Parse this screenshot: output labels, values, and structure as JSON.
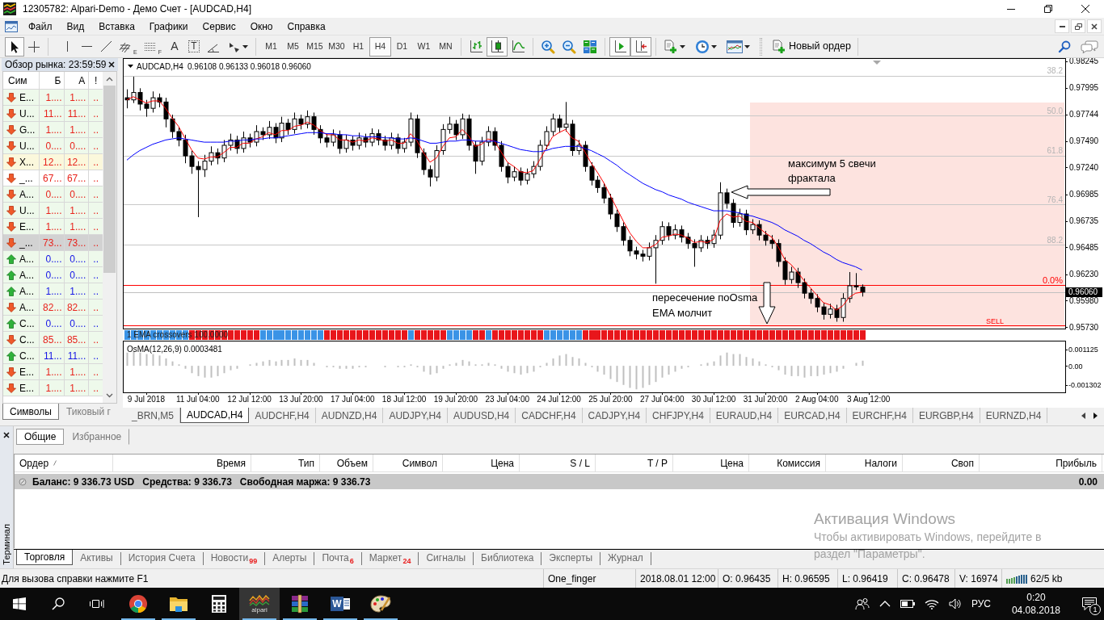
{
  "window": {
    "title": "12305782: Alpari-Demo - Демо Счет - [AUDCAD,H4]"
  },
  "menu": [
    "Файл",
    "Вид",
    "Вставка",
    "Графики",
    "Сервис",
    "Окно",
    "Справка"
  ],
  "toolbar": {
    "tools": [
      {
        "kind": "cursor",
        "selected": true
      },
      {
        "kind": "crosshair",
        "selected": false
      },
      {
        "kind": "vertical_line",
        "selected": false
      },
      {
        "kind": "horizontal_line",
        "selected": false
      },
      {
        "kind": "trend_line",
        "selected": false
      },
      {
        "kind": "fibo_channel",
        "label": "E",
        "selected": false
      },
      {
        "kind": "fibo",
        "label": "F",
        "selected": false
      },
      {
        "kind": "text",
        "label": "A",
        "selected": false
      },
      {
        "kind": "text_label",
        "label": "T",
        "selected": false
      },
      {
        "kind": "angle",
        "selected": false
      },
      {
        "kind": "arrows",
        "selected": false
      }
    ],
    "periods": [
      {
        "label": "M1",
        "selected": false
      },
      {
        "label": "M5",
        "selected": false
      },
      {
        "label": "M15",
        "selected": false
      },
      {
        "label": "M30",
        "selected": false
      },
      {
        "label": "H1",
        "selected": false
      },
      {
        "label": "H4",
        "selected": true
      },
      {
        "label": "D1",
        "selected": false
      },
      {
        "label": "W1",
        "selected": false
      },
      {
        "label": "MN",
        "selected": false
      }
    ],
    "chart_types": [
      {
        "kind": "bars",
        "selected": false
      },
      {
        "kind": "candles",
        "selected": true
      },
      {
        "kind": "line",
        "selected": false
      }
    ],
    "view_tools": [
      {
        "kind": "zoom_in"
      },
      {
        "kind": "zoom_out"
      },
      {
        "kind": "tile"
      }
    ],
    "scroll_tools": [
      {
        "kind": "autoscroll",
        "selected": true
      },
      {
        "kind": "shift",
        "selected": true
      }
    ],
    "menus": [
      {
        "kind": "new_chart"
      },
      {
        "kind": "clock"
      },
      {
        "kind": "templates"
      }
    ],
    "new_order": "Новый ордер"
  },
  "market_watch": {
    "title": "Обзор рынка: 23:59:59",
    "columns": [
      "Сим",
      "Б",
      "А",
      "!"
    ],
    "rows": [
      {
        "rising": false,
        "symbol": "E...",
        "bid": "1....",
        "ask": "1....",
        "spread": "..",
        "color": "#eef9eb",
        "selected": false
      },
      {
        "rising": false,
        "symbol": "U...",
        "bid": "11...",
        "ask": "11...",
        "spread": "..",
        "color": "#eef9eb",
        "selected": false
      },
      {
        "rising": false,
        "symbol": "G...",
        "bid": "1....",
        "ask": "1....",
        "spread": "..",
        "color": "#eef9eb",
        "selected": false
      },
      {
        "rising": false,
        "symbol": "U...",
        "bid": "0....",
        "ask": "0....",
        "spread": "..",
        "color": "#eef9eb",
        "selected": false
      },
      {
        "rising": false,
        "symbol": "X...",
        "bid": "12...",
        "ask": "12...",
        "spread": "..",
        "color": "#fbf8dc",
        "selected": false
      },
      {
        "rising": false,
        "symbol": "_...",
        "bid": "67...",
        "ask": "67...",
        "spread": "..",
        "color": "#ffffff",
        "selected": false
      },
      {
        "rising": false,
        "symbol": "A...",
        "bid": "0....",
        "ask": "0....",
        "spread": "..",
        "color": "#eef9eb",
        "selected": false
      },
      {
        "rising": false,
        "symbol": "U...",
        "bid": "1....",
        "ask": "1....",
        "spread": "..",
        "color": "#eef9eb",
        "selected": false
      },
      {
        "rising": false,
        "symbol": "E...",
        "bid": "1....",
        "ask": "1....",
        "spread": "..",
        "color": "#eef9eb",
        "selected": false
      },
      {
        "rising": false,
        "symbol": "_...",
        "bid": "73...",
        "ask": "73...",
        "spread": "..",
        "selected": true
      },
      {
        "rising": true,
        "symbol": "A...",
        "bid": "0....",
        "ask": "0....",
        "spread": "..",
        "color": "#eef9eb",
        "selected": false
      },
      {
        "rising": true,
        "symbol": "A...",
        "bid": "0....",
        "ask": "0....",
        "spread": "..",
        "color": "#eef9eb",
        "selected": false
      },
      {
        "rising": true,
        "symbol": "A...",
        "bid": "1....",
        "ask": "1....",
        "spread": "..",
        "color": "#eef9eb",
        "selected": false
      },
      {
        "rising": false,
        "symbol": "A...",
        "bid": "82...",
        "ask": "82...",
        "spread": "..",
        "color": "#eef9eb",
        "selected": false
      },
      {
        "rising": true,
        "symbol": "C...",
        "bid": "0....",
        "ask": "0....",
        "spread": "..",
        "color": "#eef9eb",
        "selected": false
      },
      {
        "rising": false,
        "symbol": "C...",
        "bid": "85...",
        "ask": "85...",
        "spread": "..",
        "color": "#eef9eb",
        "selected": false
      },
      {
        "rising": true,
        "symbol": "C...",
        "bid": "11...",
        "ask": "11...",
        "spread": "..",
        "color": "#eef9eb",
        "selected": false
      },
      {
        "rising": false,
        "symbol": "E...",
        "bid": "1....",
        "ask": "1....",
        "spread": "..",
        "color": "#eef9eb",
        "selected": false
      },
      {
        "rising": false,
        "symbol": "E...",
        "bid": "1....",
        "ask": "1....",
        "spread": "..",
        "color": "#eef9eb",
        "selected": false
      }
    ],
    "tabs": [
      {
        "label": "Символы",
        "selected": true
      },
      {
        "label": "Тиковый г",
        "selected": false
      }
    ]
  },
  "chart": {
    "header": {
      "symbol": "AUDCAD,H4",
      "values": "0.96108 0.96133 0.96018 0.96060"
    },
    "strip_label": "1 EMA crossovers 100.0000",
    "chart_data": [
      {
        "type": "candlestick",
        "categories": [
          null,
          null,
          null,
          null,
          null,
          null,
          null,
          null,
          null,
          null,
          null,
          null,
          null,
          null,
          null,
          null,
          null,
          null,
          null,
          null,
          null,
          null,
          null,
          null,
          null,
          null,
          null,
          null,
          null,
          null,
          null,
          null,
          null,
          null,
          null,
          null,
          null,
          null,
          null,
          null,
          null,
          null,
          null,
          null,
          null,
          null,
          null,
          null,
          null,
          null,
          null,
          null,
          null,
          null,
          null,
          null,
          null,
          null,
          null,
          null,
          null,
          null,
          null,
          null,
          null,
          null,
          null,
          null,
          null,
          null,
          null,
          null,
          null,
          null,
          null,
          null,
          null,
          null,
          null,
          null,
          null,
          null,
          null,
          null,
          null,
          null,
          null,
          null,
          null,
          null,
          null,
          null,
          null,
          null,
          null,
          null,
          null,
          null,
          null,
          null,
          null,
          null,
          null,
          null,
          null,
          null,
          null,
          null,
          null,
          null,
          null,
          null,
          null,
          null,
          null,
          null,
          null,
          null,
          null,
          null,
          null,
          null,
          null,
          null,
          null,
          null,
          null,
          null,
          null,
          null,
          null,
          null,
          null,
          null,
          null,
          null,
          null,
          null,
          null,
          null,
          null,
          null,
          null,
          null,
          null,
          null
        ],
        "ohlc": [
          [
            0.979,
            0.9798,
            0.978,
            0.9788
          ],
          [
            0.9788,
            0.981,
            0.9785,
            0.9795
          ],
          [
            0.9795,
            0.9799,
            0.9778,
            0.9784
          ],
          [
            0.9784,
            0.9788,
            0.9772,
            0.978
          ],
          [
            0.978,
            0.9796,
            0.9776,
            0.979
          ],
          [
            0.979,
            0.9794,
            0.9781,
            0.9786
          ],
          [
            0.9786,
            0.979,
            0.9762,
            0.977
          ],
          [
            0.977,
            0.9774,
            0.9752,
            0.9758
          ],
          [
            0.9758,
            0.9762,
            0.9744,
            0.975
          ],
          [
            0.975,
            0.9755,
            0.9728,
            0.9735
          ],
          [
            0.9735,
            0.974,
            0.9718,
            0.9725
          ],
          [
            0.9725,
            0.973,
            0.9677,
            0.9722
          ],
          [
            0.9722,
            0.9736,
            0.9715,
            0.973
          ],
          [
            0.973,
            0.9744,
            0.9726,
            0.9738
          ],
          [
            0.9738,
            0.9742,
            0.9727,
            0.9733
          ],
          [
            0.9733,
            0.975,
            0.9729,
            0.9745
          ],
          [
            0.9745,
            0.9756,
            0.974,
            0.975
          ],
          [
            0.975,
            0.9754,
            0.9737,
            0.9742
          ],
          [
            0.9742,
            0.9758,
            0.9738,
            0.9752
          ],
          [
            0.9752,
            0.9756,
            0.9743,
            0.9748
          ],
          [
            0.9748,
            0.9764,
            0.9744,
            0.9758
          ],
          [
            0.9758,
            0.9762,
            0.975,
            0.9755
          ],
          [
            0.9755,
            0.9768,
            0.9751,
            0.9762
          ],
          [
            0.9762,
            0.9766,
            0.9747,
            0.9752
          ],
          [
            0.9752,
            0.9772,
            0.9748,
            0.9766
          ],
          [
            0.9766,
            0.977,
            0.9755,
            0.976
          ],
          [
            0.976,
            0.9776,
            0.9756,
            0.977
          ],
          [
            0.977,
            0.9774,
            0.976,
            0.9765
          ],
          [
            0.9765,
            0.9778,
            0.9761,
            0.9772
          ],
          [
            0.9772,
            0.9776,
            0.9755,
            0.976
          ],
          [
            0.976,
            0.9764,
            0.9747,
            0.9752
          ],
          [
            0.9752,
            0.9756,
            0.9743,
            0.9748
          ],
          [
            0.9748,
            0.976,
            0.9744,
            0.9755
          ],
          [
            0.9755,
            0.9759,
            0.9737,
            0.9742
          ],
          [
            0.9742,
            0.9755,
            0.9738,
            0.975
          ],
          [
            0.975,
            0.9754,
            0.974,
            0.9745
          ],
          [
            0.9745,
            0.9757,
            0.9741,
            0.9752
          ],
          [
            0.9752,
            0.9756,
            0.9743,
            0.9748
          ],
          [
            0.9748,
            0.9761,
            0.9744,
            0.9756
          ],
          [
            0.9756,
            0.976,
            0.9745,
            0.975
          ],
          [
            0.975,
            0.9754,
            0.974,
            0.9745
          ],
          [
            0.9745,
            0.9757,
            0.9741,
            0.9752
          ],
          [
            0.9752,
            0.9756,
            0.9737,
            0.9742
          ],
          [
            0.9742,
            0.9752,
            0.9738,
            0.9748
          ],
          [
            0.9748,
            0.9776,
            0.9744,
            0.977
          ],
          [
            0.977,
            0.9774,
            0.9733,
            0.9738
          ],
          [
            0.9738,
            0.9742,
            0.9717,
            0.9722
          ],
          [
            0.9722,
            0.9726,
            0.9706,
            0.9715
          ],
          [
            0.9715,
            0.9745,
            0.9711,
            0.974
          ],
          [
            0.974,
            0.9765,
            0.9736,
            0.976
          ],
          [
            0.976,
            0.9772,
            0.9756,
            0.9765
          ],
          [
            0.9765,
            0.9769,
            0.975,
            0.9755
          ],
          [
            0.9755,
            0.9775,
            0.9751,
            0.977
          ],
          [
            0.977,
            0.9774,
            0.974,
            0.9745
          ],
          [
            0.9745,
            0.9749,
            0.9718,
            0.973
          ],
          [
            0.973,
            0.9753,
            0.9726,
            0.9748
          ],
          [
            0.9748,
            0.9763,
            0.9744,
            0.9758
          ],
          [
            0.9758,
            0.9762,
            0.974,
            0.9745
          ],
          [
            0.9745,
            0.9749,
            0.972,
            0.9725
          ],
          [
            0.9725,
            0.9729,
            0.9709,
            0.9715
          ],
          [
            0.9715,
            0.9725,
            0.9711,
            0.972
          ],
          [
            0.972,
            0.9724,
            0.9707,
            0.9712
          ],
          [
            0.9712,
            0.9723,
            0.9708,
            0.9718
          ],
          [
            0.9718,
            0.973,
            0.9714,
            0.9725
          ],
          [
            0.9725,
            0.975,
            0.9721,
            0.9745
          ],
          [
            0.9745,
            0.9763,
            0.9741,
            0.9758
          ],
          [
            0.9758,
            0.9775,
            0.9754,
            0.977
          ],
          [
            0.977,
            0.9774,
            0.9757,
            0.9762
          ],
          [
            0.9762,
            0.9786,
            0.9758,
            0.9765
          ],
          [
            0.9765,
            0.9769,
            0.9735,
            0.974
          ],
          [
            0.974,
            0.975,
            0.9736,
            0.9745
          ],
          [
            0.9745,
            0.9749,
            0.972,
            0.9725
          ],
          [
            0.9725,
            0.9729,
            0.9707,
            0.9712
          ],
          [
            0.9712,
            0.9716,
            0.97,
            0.9705
          ],
          [
            0.9705,
            0.9709,
            0.969,
            0.9695
          ],
          [
            0.9695,
            0.9699,
            0.9675,
            0.968
          ],
          [
            0.968,
            0.9684,
            0.9663,
            0.9668
          ],
          [
            0.9668,
            0.9672,
            0.965,
            0.9655
          ],
          [
            0.9655,
            0.9659,
            0.964,
            0.9645
          ],
          [
            0.9645,
            0.9649,
            0.9637,
            0.9642
          ],
          [
            0.9642,
            0.9646,
            0.9635,
            0.964
          ],
          [
            0.964,
            0.9653,
            0.9636,
            0.9648
          ],
          [
            0.9648,
            0.966,
            0.9614,
            0.9655
          ],
          [
            0.9655,
            0.9673,
            0.9651,
            0.9668
          ],
          [
            0.9668,
            0.9672,
            0.9655,
            0.966
          ],
          [
            0.966,
            0.967,
            0.9656,
            0.9665
          ],
          [
            0.9665,
            0.9669,
            0.9653,
            0.9658
          ],
          [
            0.9658,
            0.9662,
            0.9647,
            0.9652
          ],
          [
            0.9652,
            0.9656,
            0.963,
            0.9648
          ],
          [
            0.9648,
            0.966,
            0.9644,
            0.9655
          ],
          [
            0.9655,
            0.9659,
            0.9647,
            0.9652
          ],
          [
            0.9652,
            0.9665,
            0.9648,
            0.966
          ],
          [
            0.966,
            0.971,
            0.9656,
            0.97
          ],
          [
            0.97,
            0.9704,
            0.9685,
            0.969
          ],
          [
            0.969,
            0.9694,
            0.9667,
            0.9672
          ],
          [
            0.9672,
            0.9685,
            0.9668,
            0.968
          ],
          [
            0.968,
            0.9684,
            0.966,
            0.9665
          ],
          [
            0.9665,
            0.9675,
            0.9661,
            0.967
          ],
          [
            0.967,
            0.9674,
            0.9655,
            0.966
          ],
          [
            0.966,
            0.9664,
            0.965,
            0.9655
          ],
          [
            0.9655,
            0.966,
            0.9647,
            0.9652
          ],
          [
            0.9652,
            0.9656,
            0.963,
            0.9635
          ],
          [
            0.9635,
            0.9639,
            0.9613,
            0.9618
          ],
          [
            0.9618,
            0.963,
            0.9614,
            0.9625
          ],
          [
            0.9625,
            0.9629,
            0.961,
            0.9615
          ],
          [
            0.9615,
            0.9619,
            0.96,
            0.9605
          ],
          [
            0.9605,
            0.9609,
            0.9595,
            0.96
          ],
          [
            0.96,
            0.9604,
            0.9587,
            0.9592
          ],
          [
            0.9592,
            0.9596,
            0.958,
            0.9585
          ],
          [
            0.9585,
            0.9595,
            0.9581,
            0.959
          ],
          [
            0.959,
            0.9594,
            0.9578,
            0.9582
          ],
          [
            0.9582,
            0.9605,
            0.9578,
            0.96
          ],
          [
            0.96,
            0.9625,
            0.9596,
            0.9612
          ],
          [
            0.9612,
            0.9624,
            0.9608,
            0.9611
          ],
          [
            0.96108,
            0.96133,
            0.96018,
            0.9606
          ],
          null,
          null,
          null,
          null,
          null,
          null,
          null,
          null,
          null,
          null,
          null,
          null,
          null,
          null,
          null,
          null,
          null,
          null,
          null,
          null,
          null,
          null,
          null,
          null,
          null,
          null,
          null,
          null,
          null,
          null,
          null
        ],
        "series": [
          {
            "type": "line",
            "color": "#ff0000",
            "values": [
              0.9788,
              0.9791,
              0.9788,
              0.9785,
              0.9787,
              0.9787,
              0.978,
              0.9771,
              0.9763,
              0.9752,
              0.9741,
              0.9733,
              0.9732,
              0.9734,
              0.9734,
              0.9738,
              0.9743,
              0.9743,
              0.9747,
              0.9747,
              0.9751,
              0.9753,
              0.9757,
              0.9755,
              0.9759,
              0.9759,
              0.9763,
              0.9764,
              0.9767,
              0.9764,
              0.9759,
              0.9755,
              0.9755,
              0.975,
              0.975,
              0.9748,
              0.975,
              0.9749,
              0.9752,
              0.9751,
              0.9749,
              0.975,
              0.9747,
              0.9747,
              0.9756,
              0.9749,
              0.9738,
              0.9729,
              0.9733,
              0.9744,
              0.9752,
              0.9753,
              0.976,
              0.9754,
              0.9744,
              0.9746,
              0.9751,
              0.9749,
              0.9739,
              0.9729,
              0.9725,
              0.972,
              0.9719,
              0.9721,
              0.9731,
              0.9742,
              0.9753,
              0.9757,
              0.976,
              0.9752,
              0.9749,
              0.9739,
              0.9728,
              0.9719,
              0.9709,
              0.9697,
              0.9685,
              0.9673,
              0.9662,
              0.9654,
              0.9648,
              0.9648,
              0.9651,
              0.9658,
              0.9659,
              0.9661,
              0.966,
              0.9657,
              0.9653,
              0.9654,
              0.9653,
              0.9656,
              0.9674,
              0.968,
              0.9677,
              0.9678,
              0.9673,
              0.9672,
              0.9667,
              0.9662,
              0.9658,
              0.9649,
              0.9637,
              0.9632,
              0.9625,
              0.9617,
              0.961,
              0.9603,
              0.9596,
              0.9594,
              0.9589,
              0.9593,
              0.9601,
              0.9605,
              0.9606,
              null,
              null,
              null,
              null,
              null,
              null,
              null,
              null,
              null,
              null,
              null,
              null,
              null,
              null,
              null,
              null,
              null,
              null,
              null,
              null,
              null,
              null,
              null,
              null,
              null,
              null,
              null,
              null,
              null,
              null,
              null
            ]
          },
          {
            "type": "line",
            "color": "#0000ff",
            "values": [
              0.9731,
              0.9736,
              0.974,
              0.9743,
              0.9746,
              0.9748,
              0.975,
              0.9751,
              0.9752,
              0.9751,
              0.975,
              0.9749,
              0.9748,
              0.9748,
              0.9748,
              0.9748,
              0.9749,
              0.9749,
              0.975,
              0.975,
              0.9751,
              0.9751,
              0.9752,
              0.9752,
              0.9753,
              0.9754,
              0.9755,
              0.9756,
              0.9757,
              0.9757,
              0.9757,
              0.9756,
              0.9756,
              0.9755,
              0.9755,
              0.9754,
              0.9754,
              0.9753,
              0.9753,
              0.9753,
              0.9752,
              0.9752,
              0.9751,
              0.9751,
              0.9752,
              0.9751,
              0.9749,
              0.9747,
              0.9747,
              0.9748,
              0.9749,
              0.9749,
              0.975,
              0.975,
              0.9749,
              0.9749,
              0.9749,
              0.9749,
              0.9747,
              0.9745,
              0.9743,
              0.9741,
              0.974,
              0.9739,
              0.9739,
              0.974,
              0.9742,
              0.9743,
              0.9744,
              0.9744,
              0.9744,
              0.9742,
              0.974,
              0.9737,
              0.9734,
              0.973,
              0.9726,
              0.9721,
              0.9717,
              0.9713,
              0.9709,
              0.9706,
              0.9703,
              0.9701,
              0.9698,
              0.9696,
              0.9694,
              0.9691,
              0.9689,
              0.9687,
              0.9685,
              0.9683,
              0.9683,
              0.9683,
              0.9682,
              0.9681,
              0.9679,
              0.9678,
              0.9676,
              0.9674,
              0.9672,
              0.9669,
              0.9665,
              0.9662,
              0.9659,
              0.9655,
              0.9652,
              0.9648,
              0.9644,
              0.9641,
              0.9637,
              0.9634,
              0.9632,
              0.963,
              0.9627,
              null,
              null,
              null,
              null,
              null,
              null,
              null,
              null,
              null,
              null,
              null,
              null,
              null,
              null,
              null,
              null,
              null,
              null,
              null,
              null,
              null,
              null,
              null,
              null,
              null,
              null,
              null,
              null,
              null,
              null,
              null
            ]
          }
        ],
        "ylim": [
          0.95715,
          0.9826
        ],
        "yticks": [
          {
            "value": 0.98245,
            "label": "0.98245"
          },
          {
            "value": 0.97995,
            "label": "0.97995"
          },
          {
            "value": 0.97744,
            "label": "0.97744"
          },
          {
            "value": 0.9749,
            "label": "0.97490"
          },
          {
            "value": 0.9724,
            "label": "0.97240"
          },
          {
            "value": 0.96985,
            "label": "0.96985"
          },
          {
            "value": 0.96735,
            "label": "0.96735"
          },
          {
            "value": 0.96485,
            "label": "0.96485"
          },
          {
            "value": 0.9623,
            "label": "0.96230"
          },
          {
            "value": 0.9598,
            "label": "0.95980"
          },
          {
            "value": 0.9573,
            "label": "0.95730"
          }
        ],
        "ref_lines": [
          {
            "axis": "y",
            "value": 0.98108,
            "color": "#c8c8c8"
          },
          {
            "axis": "y",
            "value": 0.97734,
            "color": "#c8c8c8"
          },
          {
            "axis": "y",
            "value": 0.97353,
            "color": "#c8c8c8"
          },
          {
            "axis": "y",
            "value": 0.96889,
            "color": "#c8c8c8"
          },
          {
            "axis": "y",
            "value": 0.96508,
            "color": "#c8c8c8"
          },
          {
            "axis": "y",
            "value": 0.96127,
            "color": "#ff0000"
          },
          {
            "axis": "y",
            "value": 0.9606,
            "label": "0.96060",
            "color": "#c0c0c0"
          },
          {
            "axis": "y",
            "value": 0.95746,
            "color": "#ff0000"
          }
        ],
        "annotations": [
          "38.2",
          "50.0",
          "максимум 5 свечи",
          "61.8",
          "фрактала",
          "76.4",
          "88.2",
          "0.0%",
          "пересечение поOsma",
          "EMA молчит",
          "SELL"
        ]
      },
      {
        "type": "bar",
        "title": "OsMA(12,26,9) 0.0003481",
        "color": "#c0c0c0",
        "ylim": [
          -0.00175,
          0.0016
        ],
        "yticks": [
          {
            "value": 0.001125,
            "label": "0.001125"
          },
          {
            "value": 0,
            "label": "0.00"
          },
          {
            "value": -0.001302,
            "label": "-0.001302"
          }
        ],
        "categories": [
          null,
          null,
          null,
          "9 Jul 2018",
          null,
          null,
          null,
          null,
          null,
          null,
          null,
          "11 Jul 04:00",
          null,
          null,
          null,
          null,
          null,
          null,
          null,
          "12 Jul 12:00",
          null,
          null,
          null,
          null,
          null,
          null,
          null,
          "13 Jul 20:00",
          null,
          null,
          null,
          null,
          null,
          null,
          null,
          "17 Jul 04:00",
          null,
          null,
          null,
          null,
          null,
          null,
          null,
          "18 Jul 12:00",
          null,
          null,
          null,
          null,
          null,
          null,
          null,
          "19 Jul 20:00",
          null,
          null,
          null,
          null,
          null,
          null,
          null,
          "23 Jul 04:00",
          null,
          null,
          null,
          null,
          null,
          null,
          null,
          "24 Jul 12:00",
          null,
          null,
          null,
          null,
          null,
          null,
          null,
          "25 Jul 20:00",
          null,
          null,
          null,
          null,
          null,
          null,
          null,
          "27 Jul 04:00",
          null,
          null,
          null,
          null,
          null,
          null,
          null,
          "30 Jul 12:00",
          null,
          null,
          null,
          null,
          null,
          null,
          null,
          "31 Jul 20:00",
          null,
          null,
          null,
          null,
          null,
          null,
          null,
          "2 Aug 04:00",
          null,
          null,
          null,
          null,
          null,
          null,
          null,
          "3 Aug 12:00",
          null,
          null,
          null,
          null,
          null,
          null,
          null,
          null,
          null,
          null,
          null,
          null,
          null,
          null,
          null,
          null,
          null,
          null,
          null,
          null,
          null,
          null,
          null,
          null,
          null,
          null,
          null,
          null,
          null,
          null
        ],
        "values": [
          0.0009,
          0.001,
          0.0009,
          0.0008,
          0.0008,
          0.0007,
          0.0005,
          0.0003,
          0.0001,
          -0.0002,
          -0.0005,
          -0.0007,
          -0.0008,
          -0.0008,
          -0.0007,
          -0.0005,
          -0.0003,
          -0.0002,
          0,
          0.0001,
          0.0002,
          0.0003,
          0.0004,
          0.0003,
          0.0004,
          0.0004,
          0.0005,
          0.0004,
          0.0004,
          0.0002,
          0,
          -0.0001,
          -0.0001,
          -0.0002,
          -0.0002,
          -0.0002,
          -0.0001,
          -0.0001,
          0,
          0,
          -0.0001,
          0,
          -0.0001,
          -0.0001,
          0.0001,
          -0.0001,
          -0.0004,
          -0.0006,
          -0.0005,
          -0.0002,
          0.0001,
          0.0002,
          0.0004,
          0.0003,
          0.0001,
          0.0001,
          0.0002,
          0.0001,
          -0.0002,
          -0.0004,
          -0.0005,
          -0.0006,
          -0.0005,
          -0.0004,
          -0.0001,
          0.0002,
          0.0005,
          0.0007,
          0.0008,
          0.0006,
          0.0005,
          0.0002,
          -0.0001,
          -0.0004,
          -0.0006,
          -0.0009,
          -0.0011,
          -0.0013,
          -0.0015,
          -0.0016,
          -0.0015,
          -0.0013,
          -0.0011,
          -0.0008,
          -0.0006,
          -0.0004,
          -0.0002,
          -0.0001,
          0,
          0.0001,
          0.0002,
          0.0003,
          0.0007,
          0.0009,
          0.0008,
          0.0008,
          0.0006,
          0.0005,
          0.0003,
          0.0001,
          -0.0001,
          -0.0003,
          -0.0006,
          -0.0007,
          -0.0007,
          -0.0008,
          -0.0007,
          -0.0007,
          -0.0006,
          -0.0005,
          -0.0004,
          -0.0002,
          0,
          0.0002,
          0.00035,
          null,
          null,
          null,
          null,
          null,
          null,
          null,
          null,
          null,
          null,
          null,
          null,
          null,
          null,
          null,
          null,
          null,
          null,
          null,
          null,
          null,
          null,
          null,
          null,
          null,
          null,
          null,
          null,
          null,
          null,
          null
        ]
      }
    ],
    "tabs": [
      {
        "label": "_BRN,M5",
        "selected": false
      },
      {
        "label": "AUDCAD,H4",
        "selected": true
      },
      {
        "label": "AUDCHF,H4",
        "selected": false
      },
      {
        "label": "AUDNZD,H4",
        "selected": false
      },
      {
        "label": "AUDJPY,H4",
        "selected": false
      },
      {
        "label": "AUDUSD,H4",
        "selected": false
      },
      {
        "label": "CADCHF,H4",
        "selected": false
      },
      {
        "label": "CADJPY,H4",
        "selected": false
      },
      {
        "label": "CHFJPY,H4",
        "selected": false
      },
      {
        "label": "EURAUD,H4",
        "selected": false
      },
      {
        "label": "EURCAD,H4",
        "selected": false
      },
      {
        "label": "EURCHF,H4",
        "selected": false
      },
      {
        "label": "EURGBP,H4",
        "selected": false
      },
      {
        "label": "EURNZD,H4",
        "selected": false
      }
    ]
  },
  "terminal": {
    "title": "Терминал",
    "filter_tabs": [
      {
        "label": "Общие",
        "selected": true
      },
      {
        "label": "Избранное",
        "selected": false
      }
    ],
    "columns": [
      "Ордер",
      "Время",
      "Тип",
      "Объем",
      "Символ",
      "Цена",
      "S / L",
      "T / P",
      "Цена",
      "Комиссия",
      "Налоги",
      "Своп",
      "Прибыль"
    ],
    "summary": {
      "balance": "Баланс: 9 336.73 USD",
      "equity": "Средства: 9 336.73",
      "free_margin": "Свободная маржа: 9 336.73",
      "profit": "0.00"
    },
    "tabs": [
      {
        "label": "Торговля",
        "selected": true
      },
      {
        "label": "Активы",
        "selected": false
      },
      {
        "label": "История Счета",
        "selected": false
      },
      {
        "label": "Новости",
        "badge": "99",
        "selected": false
      },
      {
        "label": "Алерты",
        "selected": false
      },
      {
        "label": "Почта",
        "badge": "6",
        "selected": false
      },
      {
        "label": "Маркет",
        "badge": "24",
        "selected": false
      },
      {
        "label": "Сигналы",
        "selected": false
      },
      {
        "label": "Библиотека",
        "selected": false
      },
      {
        "label": "Эксперты",
        "selected": false
      },
      {
        "label": "Журнал",
        "selected": false
      }
    ]
  },
  "activation": {
    "title": "Активация Windows",
    "text": "Чтобы активировать Windows, перейдите в раздел \"Параметры\"."
  },
  "status_bar": {
    "help": "Для вызова справки нажмите F1",
    "profile": "One_finger",
    "bar_time": "2018.08.01 12:00",
    "open": "O: 0.96435",
    "high": "H: 0.96595",
    "low": "L: 0.96419",
    "close": "C: 0.96478",
    "volume": "V: 16974",
    "traffic": "62/5 kb"
  },
  "taskbar": {
    "apps": [
      {
        "kind": "browser",
        "running": true,
        "active": false
      },
      {
        "kind": "explorer",
        "running": true,
        "active": false
      },
      {
        "kind": "calculator",
        "running": false,
        "active": false
      },
      {
        "kind": "terminal",
        "label": "alpari",
        "running": true,
        "active": true
      },
      {
        "kind": "archiver",
        "running": true,
        "active": false
      },
      {
        "kind": "word",
        "label": "W",
        "running": true,
        "active": false
      },
      {
        "kind": "paint",
        "running": true,
        "active": false
      }
    ],
    "language": "РУС",
    "time": "0:20",
    "date": "04.08.2018",
    "notifications": "1"
  }
}
